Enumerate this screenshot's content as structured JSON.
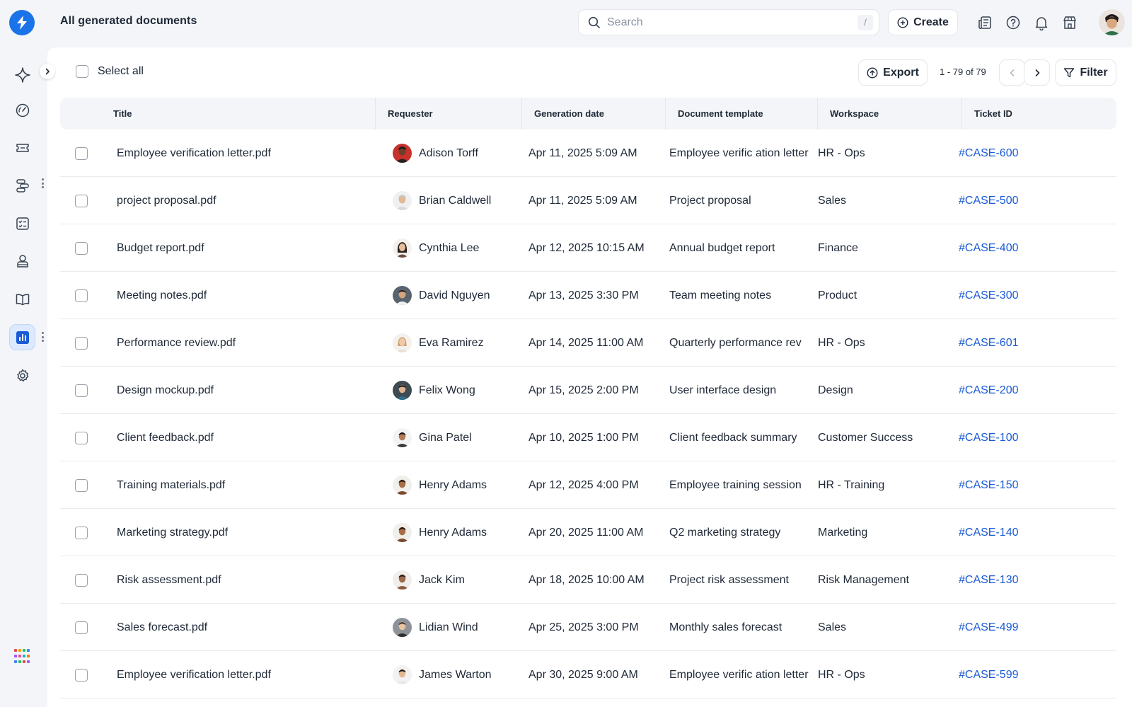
{
  "header": {
    "title": "All generated documents",
    "search_placeholder": "Search",
    "search_shortcut": "/",
    "create_label": "Create",
    "icons": [
      "logo-bolt-icon",
      "search-icon",
      "plus-circle-icon",
      "news-icon",
      "help-icon",
      "bell-icon",
      "store-icon",
      "user-avatar"
    ]
  },
  "sidebar": {
    "items": [
      {
        "name": "sparkle-icon"
      },
      {
        "name": "dashboard-icon"
      },
      {
        "name": "ticket-icon"
      },
      {
        "name": "workflow-icon"
      },
      {
        "name": "checklist-icon"
      },
      {
        "name": "agent-icon"
      },
      {
        "name": "book-icon"
      },
      {
        "name": "analytics-icon",
        "active": true
      },
      {
        "name": "settings-icon"
      }
    ],
    "apps_icon": "apps-grid-icon"
  },
  "toolbar": {
    "select_all_label": "Select all",
    "export_label": "Export",
    "pagination_text": "1 - 79 of 79",
    "filter_label": "Filter"
  },
  "table": {
    "columns": [
      "Title",
      "Requester",
      "Generation date",
      "Document template",
      "Workspace",
      "Ticket ID"
    ],
    "rows": [
      {
        "title": "Employee verification letter.pdf",
        "requester": "Adison Torff",
        "date": "Apr 11, 2025 5:09 AM",
        "template": "Employee verific ation letter",
        "workspace": "HR - Ops",
        "ticket": "#CASE-600"
      },
      {
        "title": "project proposal.pdf",
        "requester": "Brian Caldwell",
        "date": "Apr 11, 2025 5:09 AM",
        "template": "Project proposal",
        "workspace": "Sales",
        "ticket": "#CASE-500"
      },
      {
        "title": "Budget report.pdf",
        "requester": "Cynthia Lee",
        "date": "Apr 12, 2025 10:15 AM",
        "template": "Annual budget report",
        "workspace": "Finance",
        "ticket": "#CASE-400"
      },
      {
        "title": "Meeting notes.pdf",
        "requester": "David Nguyen",
        "date": "Apr 13, 2025 3:30 PM",
        "template": "Team meeting notes",
        "workspace": "Product",
        "ticket": "#CASE-300"
      },
      {
        "title": "Performance review.pdf",
        "requester": "Eva Ramirez",
        "date": "Apr 14, 2025 11:00 AM",
        "template": "Quarterly performance rev",
        "workspace": "HR - Ops",
        "ticket": "#CASE-601"
      },
      {
        "title": "Design mockup.pdf",
        "requester": "Felix Wong",
        "date": "Apr 15, 2025 2:00 PM",
        "template": "User interface design",
        "workspace": "Design",
        "ticket": "#CASE-200"
      },
      {
        "title": "Client feedback.pdf",
        "requester": "Gina Patel",
        "date": "Apr 10, 2025 1:00 PM",
        "template": "Client feedback summary",
        "workspace": "Customer Success",
        "ticket": "#CASE-100"
      },
      {
        "title": "Training materials.pdf",
        "requester": "Henry Adams",
        "date": "Apr 12, 2025 4:00 PM",
        "template": "Employee training session",
        "workspace": "HR - Training",
        "ticket": "#CASE-150"
      },
      {
        "title": "Marketing strategy.pdf",
        "requester": "Henry Adams",
        "date": "Apr 20, 2025 11:00 AM",
        "template": "Q2 marketing strategy",
        "workspace": "Marketing",
        "ticket": "#CASE-140"
      },
      {
        "title": "Risk assessment.pdf",
        "requester": "Jack Kim",
        "date": "Apr 18, 2025 10:00 AM",
        "template": "Project risk assessment",
        "workspace": "Risk Management",
        "ticket": "#CASE-130"
      },
      {
        "title": "Sales forecast.pdf",
        "requester": "Lidian Wind",
        "date": "Apr 25, 2025 3:00 PM",
        "template": "Monthly sales forecast",
        "workspace": "Sales",
        "ticket": "#CASE-499"
      },
      {
        "title": "Employee verification letter.pdf",
        "requester": "James Warton",
        "date": "Apr 30, 2025 9:00 AM",
        "template": "Employee verific ation letter",
        "workspace": "HR - Ops",
        "ticket": "#CASE-599"
      }
    ]
  },
  "colors": {
    "accent": "#1a73e8",
    "link": "#1a5bd6",
    "page_bg": "#f3f5f8"
  }
}
